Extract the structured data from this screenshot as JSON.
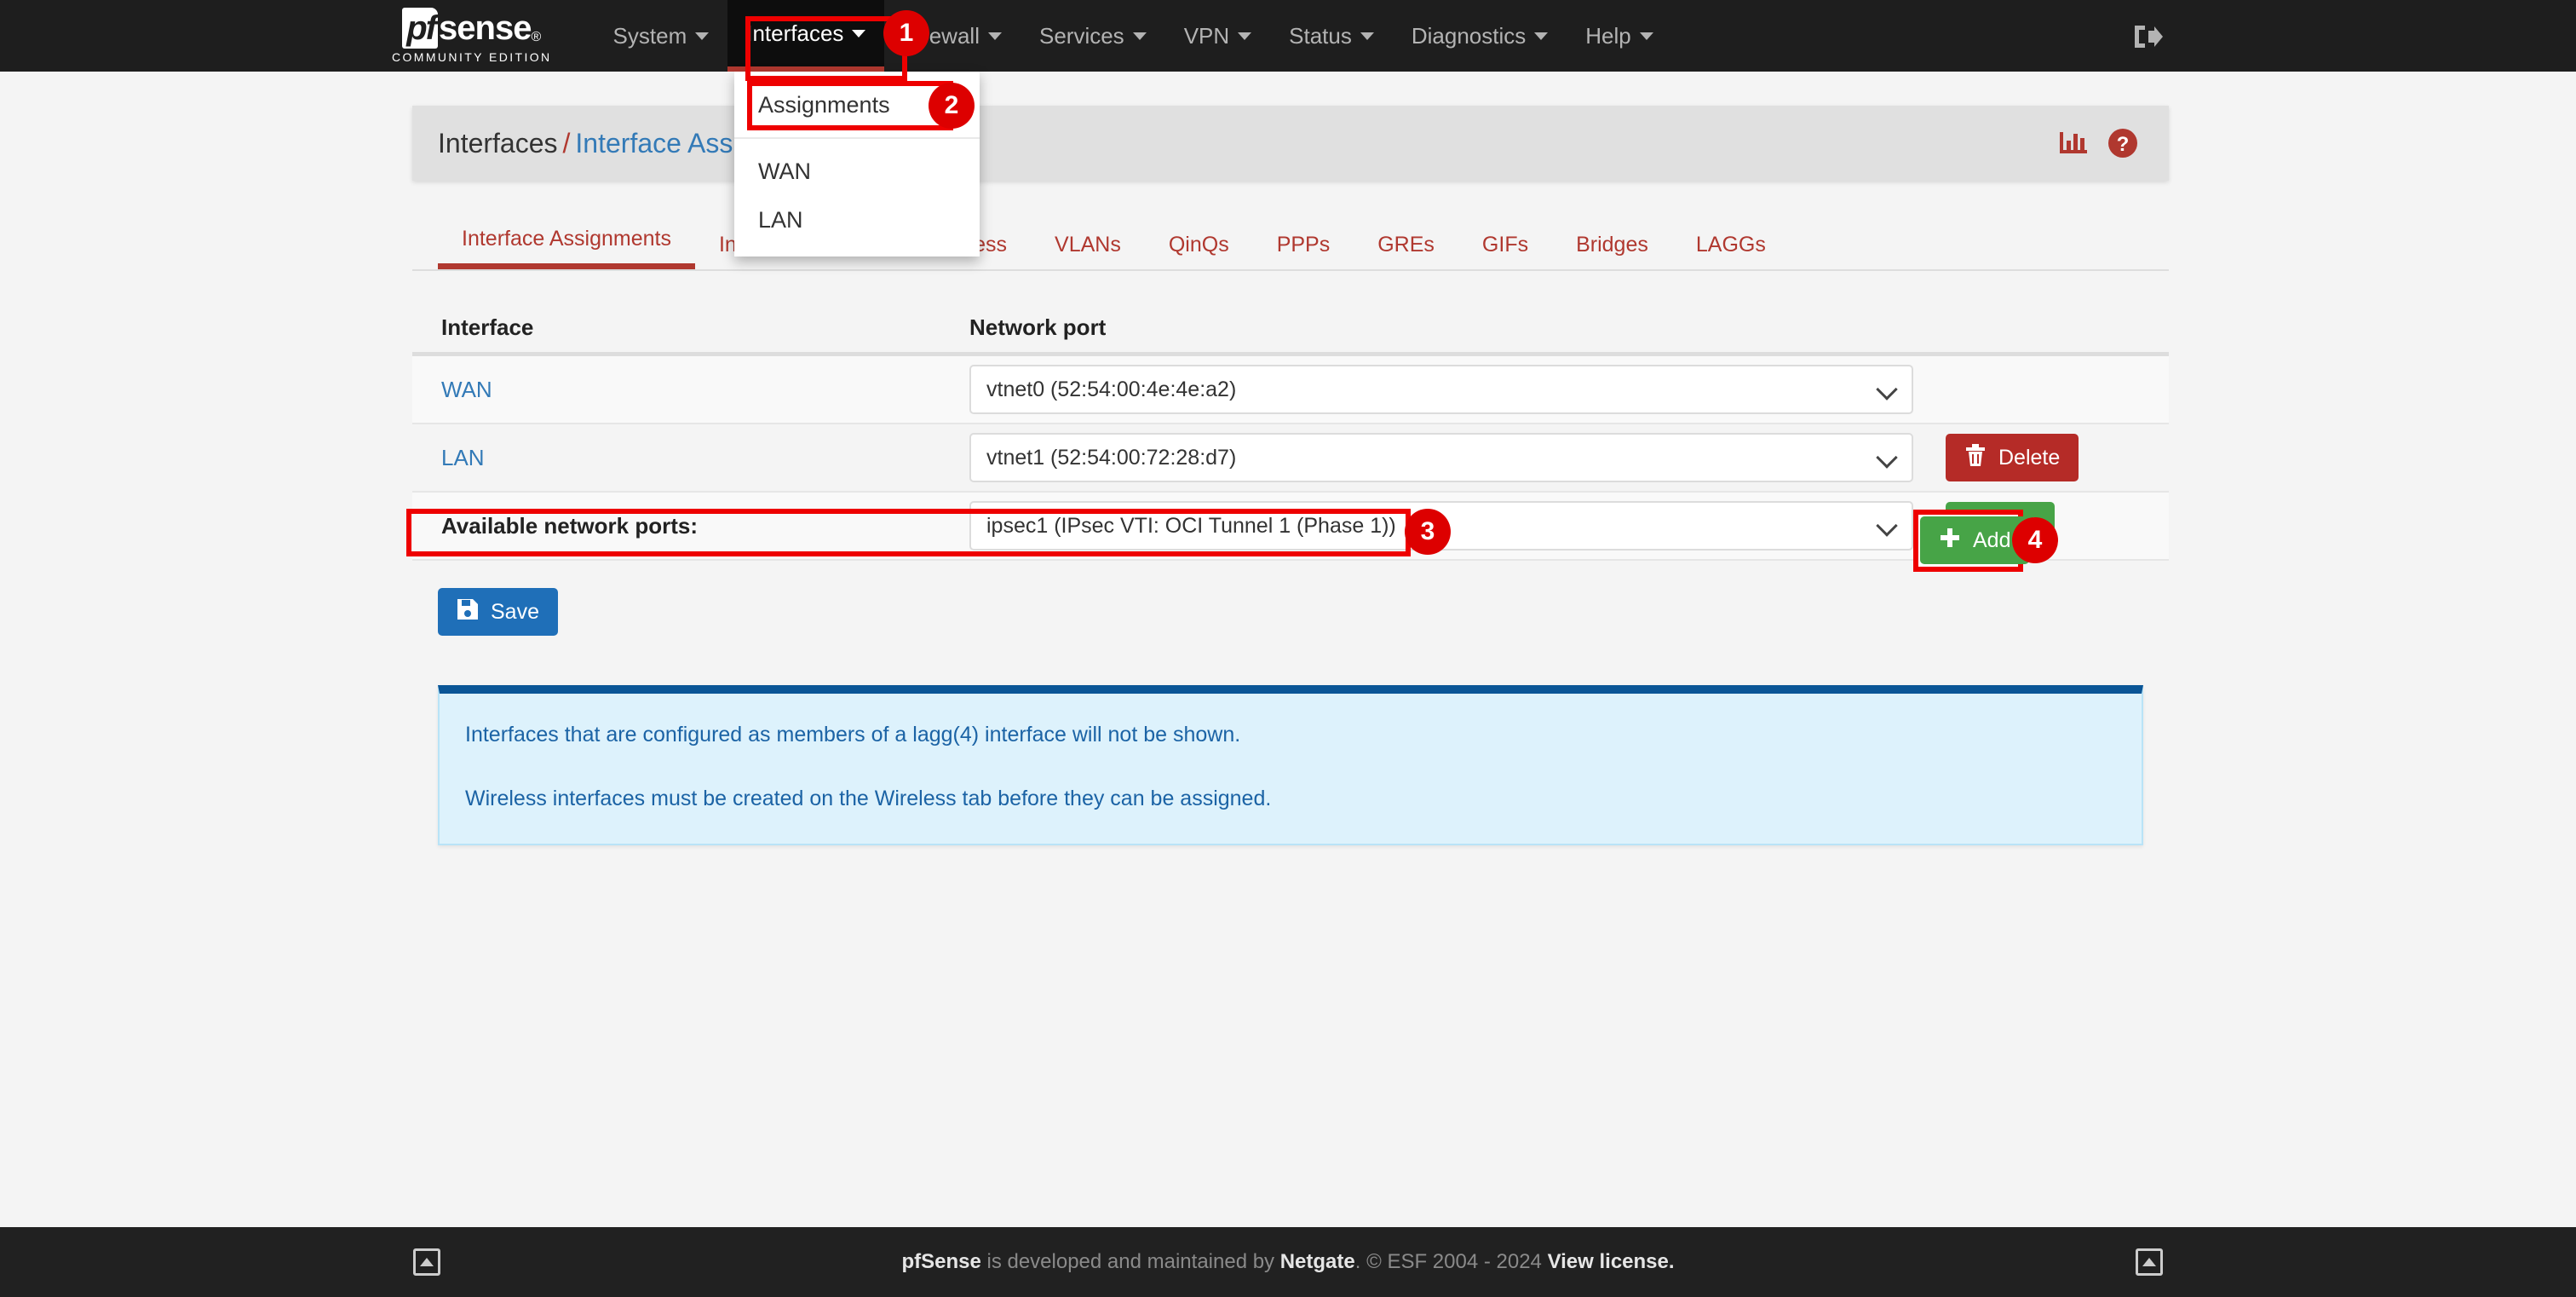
{
  "brand": {
    "logo_pf": "pf",
    "logo_sense": "sense",
    "subtitle": "COMMUNITY EDITION"
  },
  "navbar": {
    "items": [
      {
        "label": "System",
        "active": false
      },
      {
        "label": "Interfaces",
        "active": true
      },
      {
        "label": "Firewall",
        "active": false
      },
      {
        "label": "Services",
        "active": false
      },
      {
        "label": "VPN",
        "active": false
      },
      {
        "label": "Status",
        "active": false
      },
      {
        "label": "Diagnostics",
        "active": false
      },
      {
        "label": "Help",
        "active": false
      }
    ],
    "logout_icon": "logout-icon"
  },
  "dropdown": {
    "items": [
      {
        "label": "Assignments"
      },
      {
        "label": "WAN"
      },
      {
        "label": "LAN"
      }
    ]
  },
  "header": {
    "breadcrumb_root": "Interfaces",
    "breadcrumb_sep": "/",
    "breadcrumb_current": "Interface Assignments",
    "icons": [
      {
        "name": "stats-icon"
      },
      {
        "name": "help-icon"
      }
    ]
  },
  "tabs": [
    {
      "label": "Interface Assignments",
      "active": true
    },
    {
      "label": "Interface Groups",
      "active": false
    },
    {
      "label": "Wireless",
      "active": false
    },
    {
      "label": "VLANs",
      "active": false
    },
    {
      "label": "QinQs",
      "active": false
    },
    {
      "label": "PPPs",
      "active": false
    },
    {
      "label": "GREs",
      "active": false
    },
    {
      "label": "GIFs",
      "active": false
    },
    {
      "label": "Bridges",
      "active": false
    },
    {
      "label": "LAGGs",
      "active": false
    }
  ],
  "table": {
    "columns": [
      "Interface",
      "Network port"
    ],
    "rows": [
      {
        "interface": "WAN",
        "port": "vtnet0 (52:54:00:4e:4e:a2)",
        "action": null
      },
      {
        "interface": "LAN",
        "port": "vtnet1 (52:54:00:72:28:d7)",
        "action": "Delete"
      }
    ],
    "available_row": {
      "label": "Available network ports:",
      "port": "ipsec1 (IPsec VTI: OCI Tunnel 1 (Phase 1))",
      "action": "Add"
    }
  },
  "buttons": {
    "save": "Save",
    "delete": "Delete",
    "add": "Add"
  },
  "info": {
    "messages": [
      "Interfaces that are configured as members of a lagg(4) interface will not be shown.",
      "Wireless interfaces must be created on the Wireless tab before they can be assigned."
    ]
  },
  "footer": {
    "brand": "pfSense",
    "text_1": " is developed and maintained by ",
    "company": "Netgate",
    "text_2": ". © ESF 2004 - 2024 ",
    "license": "View license."
  },
  "annotations": {
    "badges": [
      {
        "number": "1"
      },
      {
        "number": "2"
      },
      {
        "number": "3"
      },
      {
        "number": "4"
      }
    ]
  },
  "colors": {
    "accent_red": "#b0382f",
    "link_blue": "#337ab7",
    "annotation_red": "#dd0000",
    "save_blue": "#1f6fb8",
    "delete_red": "#b52b27",
    "add_green": "#47a447",
    "info_bg": "#ddf2fc",
    "info_border": "#0a5596",
    "navbar_bg": "#1e1e1e"
  }
}
